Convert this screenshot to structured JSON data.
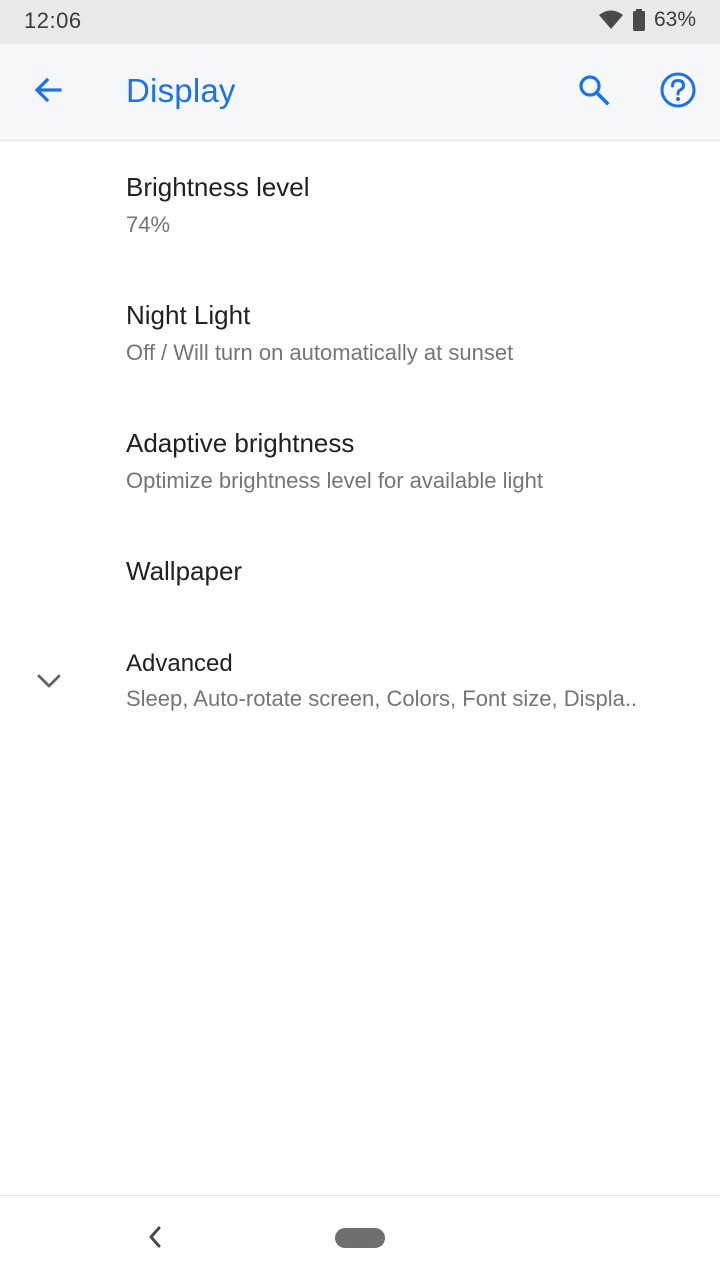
{
  "status_bar": {
    "time": "12:06",
    "battery": "63%",
    "icons": [
      "wifi-icon",
      "battery-icon"
    ]
  },
  "app_bar": {
    "title": "Display",
    "accent_color": "#1a73e8",
    "icons": [
      "back-arrow-icon",
      "search-icon",
      "help-icon"
    ]
  },
  "settings": {
    "items": [
      {
        "title": "Brightness level",
        "summary": "74%"
      },
      {
        "title": "Night Light",
        "summary": "Off / Will turn on automatically at sunset"
      },
      {
        "title": "Adaptive brightness",
        "summary": "Optimize brightness level for available light"
      },
      {
        "title": "Wallpaper"
      },
      {
        "title": "Advanced",
        "summary": "Sleep, Auto-rotate screen, Colors, Font size, Displa.."
      }
    ]
  },
  "nav_bar": {
    "icons": [
      "back-nav-icon",
      "home-pill-icon"
    ]
  }
}
